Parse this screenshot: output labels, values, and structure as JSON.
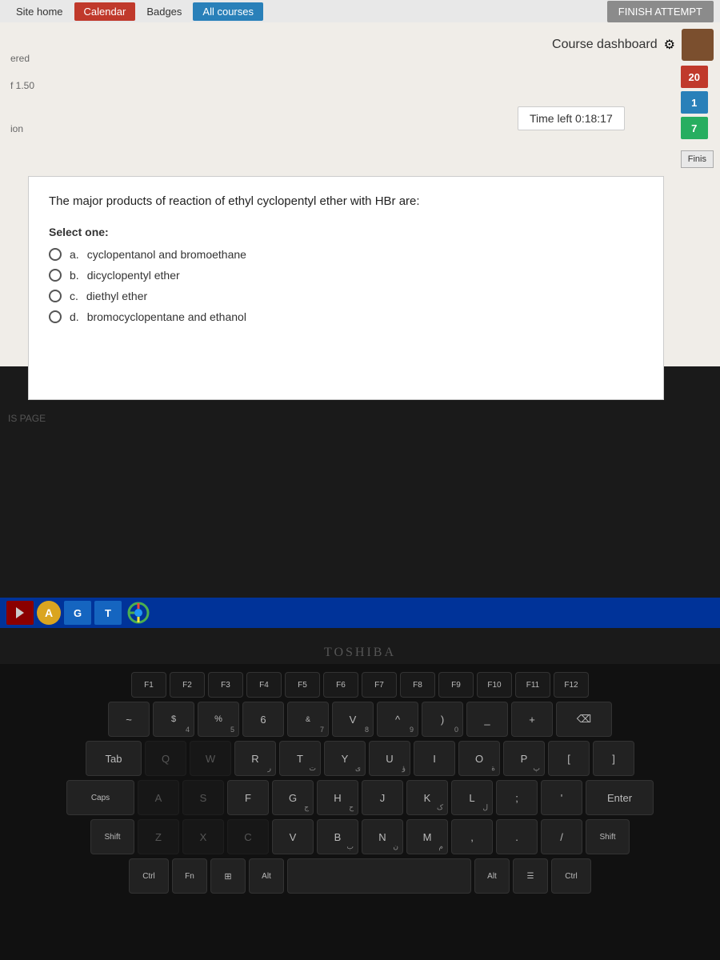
{
  "nav": {
    "items": [
      {
        "label": "Site home",
        "active": false
      },
      {
        "label": "Calendar",
        "active": true,
        "style": "red"
      },
      {
        "label": "Badges",
        "active": false
      },
      {
        "label": "All courses",
        "active": true,
        "style": "blue"
      }
    ]
  },
  "header": {
    "course_dashboard_label": "Course dashboard",
    "gear_icon": "⚙",
    "timer_label": "Time left 0:18:17"
  },
  "question": {
    "text": "The major products of reaction of ethyl cyclopentyl ether with HBr are:",
    "select_label": "Select one:",
    "options": [
      {
        "id": "a",
        "text": "cyclopentanol and bromoethane"
      },
      {
        "id": "b",
        "text": "dicyclopentyl ether"
      },
      {
        "id": "c",
        "text": "diethyl ether"
      },
      {
        "id": "d",
        "text": "bromocyclopentane and ethanol"
      }
    ]
  },
  "sidebar": {
    "left_labels": [
      "ered",
      "f 1.50",
      "ion"
    ],
    "right_numbers": [
      "20",
      "1",
      "7"
    ],
    "finish_label": "Finis"
  },
  "footer": {
    "page_nav_label": "IS PAGE",
    "finish_attempt": "FINISH ATTEMPT"
  },
  "taskbar": {
    "toshiba": "TOSHIBA"
  },
  "keyboard": {
    "row1": [
      "4",
      "5",
      "6",
      "7",
      "8",
      "9",
      "0"
    ],
    "row2": [
      "R",
      "T",
      "Y",
      "U",
      "I",
      "O",
      "P"
    ],
    "row3": [
      "F",
      "G",
      "H",
      "J",
      "K",
      "L"
    ],
    "row4": [
      "V",
      "B",
      "N",
      "M"
    ]
  }
}
